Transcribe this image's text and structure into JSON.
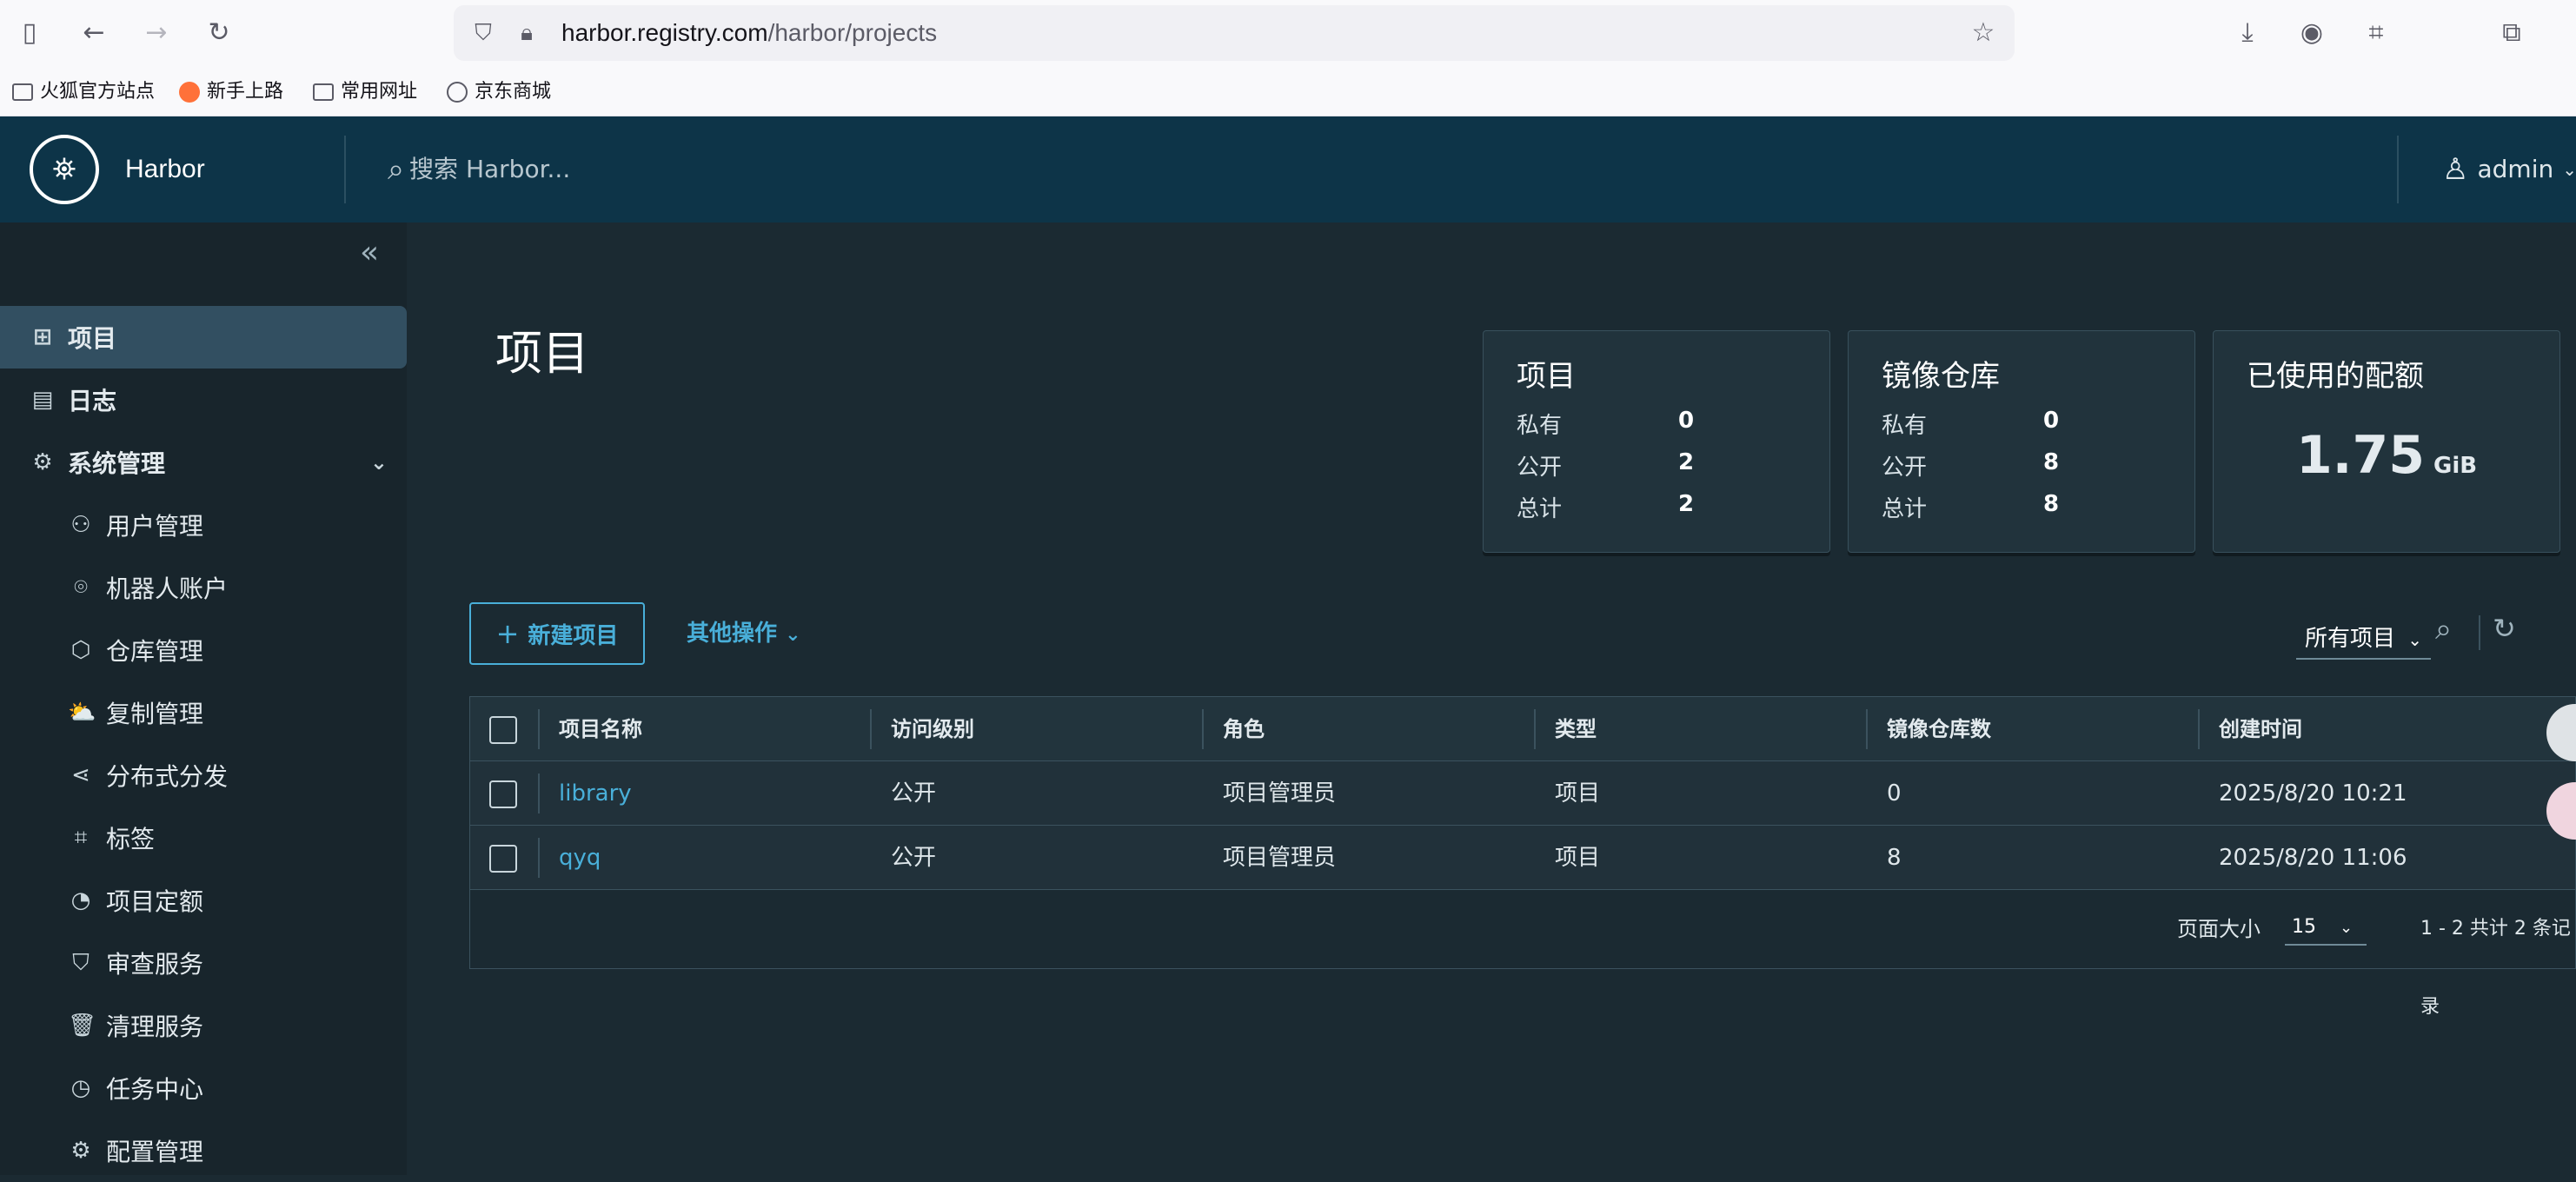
{
  "browser": {
    "url_host": "harbor.registry.com",
    "url_path": "/harbor/projects",
    "bookmarks": [
      "火狐官方站点",
      "新手上路",
      "常用网址",
      "京东商城"
    ]
  },
  "header": {
    "brand": "Harbor",
    "search_placeholder": "搜索 Harbor...",
    "user": "admin"
  },
  "sidebar": {
    "items": [
      {
        "label": "项目",
        "icon": "projects-icon"
      },
      {
        "label": "日志",
        "icon": "logs-icon"
      },
      {
        "label": "系统管理",
        "icon": "admin-icon"
      }
    ],
    "sub_items": [
      {
        "label": "用户管理",
        "icon": "users-icon"
      },
      {
        "label": "机器人账户",
        "icon": "robot-icon"
      },
      {
        "label": "仓库管理",
        "icon": "registry-icon"
      },
      {
        "label": "复制管理",
        "icon": "replication-icon"
      },
      {
        "label": "分布式分发",
        "icon": "distribution-icon"
      },
      {
        "label": "标签",
        "icon": "tag-icon"
      },
      {
        "label": "项目定额",
        "icon": "quota-icon"
      },
      {
        "label": "审查服务",
        "icon": "shield-icon"
      },
      {
        "label": "清理服务",
        "icon": "trash-icon"
      },
      {
        "label": "任务中心",
        "icon": "dashboard-icon"
      },
      {
        "label": "配置管理",
        "icon": "gear-icon"
      }
    ]
  },
  "main": {
    "title": "项目",
    "cards": {
      "projects": {
        "title": "项目",
        "rows": [
          {
            "label": "私有",
            "value": "0"
          },
          {
            "label": "公开",
            "value": "2"
          },
          {
            "label": "总计",
            "value": "2"
          }
        ]
      },
      "repos": {
        "title": "镜像仓库",
        "rows": [
          {
            "label": "私有",
            "value": "0"
          },
          {
            "label": "公开",
            "value": "8"
          },
          {
            "label": "总计",
            "value": "8"
          }
        ]
      },
      "quota": {
        "title": "已使用的配额",
        "value": "1.75",
        "unit": "GiB"
      }
    },
    "new_project": "新建项目",
    "more_actions": "其他操作",
    "filter": "所有项目"
  },
  "table": {
    "headers": [
      "项目名称",
      "访问级别",
      "角色",
      "类型",
      "镜像仓库数",
      "创建时间"
    ],
    "rows": [
      [
        "library",
        "公开",
        "项目管理员",
        "项目",
        "0",
        "2025/8/20 10:21"
      ],
      [
        "qyq",
        "公开",
        "项目管理员",
        "项目",
        "8",
        "2025/8/20 11:06"
      ]
    ],
    "page_size_label": "页面大小",
    "page_size": "15",
    "summary": "1 - 2 共计 2 条记录"
  }
}
